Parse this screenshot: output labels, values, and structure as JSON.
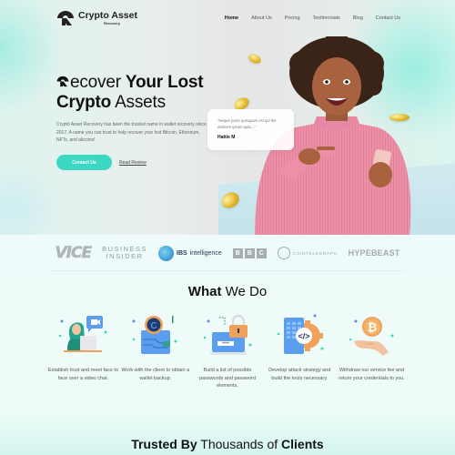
{
  "brand": {
    "name": "Crypto Asset",
    "subtitle": "Recovery"
  },
  "nav": {
    "items": [
      {
        "label": "Home",
        "active": true
      },
      {
        "label": "About Us",
        "active": false
      },
      {
        "label": "Pricing",
        "active": false
      },
      {
        "label": "Testimonials",
        "active": false
      },
      {
        "label": "Blog",
        "active": false
      },
      {
        "label": "Contact Us",
        "active": false
      }
    ]
  },
  "hero": {
    "headline_part1_light": "ecover",
    "headline_part1_bold": "Your Lost",
    "headline_part2_bold": "Crypto",
    "headline_part2_light": "Assets",
    "description": "Crypto Asset Recovery has been the trusted name in wallet recovery since 2017. A name you can trust to help recover your lost Bitcoin, Ethereum, NFTs, and altcoins!",
    "cta_label": "Contact Us",
    "secondary_link": "Read Review",
    "accent_color": "#3dd8c4"
  },
  "testimonial": {
    "quote": "\"Neque porro quisquam est qui the dolorem ipsum quia...\"",
    "author": "Hattie M"
  },
  "press_logos": [
    "VICE",
    "BUSINESS",
    "INSIDER",
    "IBS",
    "intelligence",
    "B",
    "B",
    "C",
    "COINTELEGRAPH",
    "HYPEBEAST"
  ],
  "what_we_do": {
    "title_bold": "What",
    "title_light": "We Do",
    "services": [
      {
        "icon": "video-chat-icon",
        "text": "Establish trust and meet face to face over a video chat."
      },
      {
        "icon": "crypto-wallet-icon",
        "text": "Work with the client to obtain a wallet backup."
      },
      {
        "icon": "password-lock-icon",
        "text": "Build a list of possible passwords and password elements."
      },
      {
        "icon": "code-gear-icon",
        "text": "Develop attack strategy and build the tools necessary."
      },
      {
        "icon": "bitcoin-hand-icon",
        "text": "Withdraw our service fee and return your credentials to you."
      }
    ]
  },
  "trusted": {
    "bold1": "Trusted By",
    "light": "Thousands of",
    "bold2": "Clients"
  }
}
